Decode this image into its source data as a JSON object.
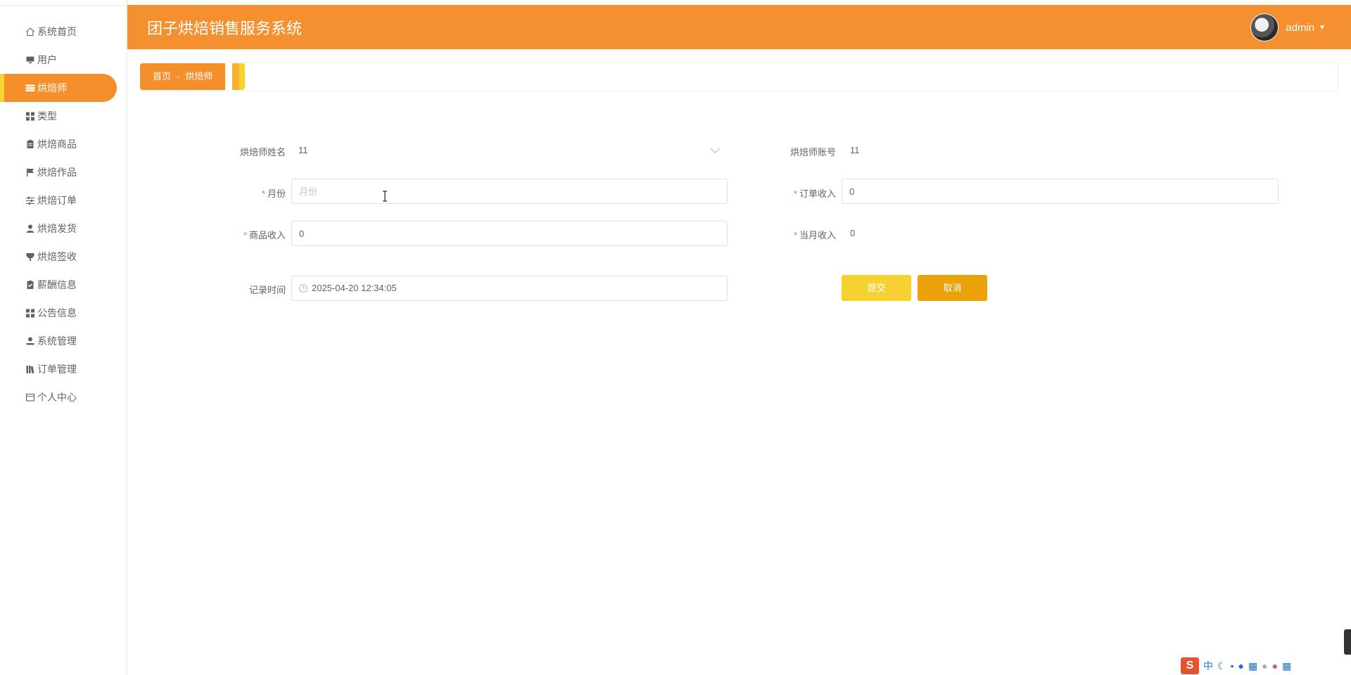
{
  "header": {
    "title": "团子烘焙销售服务系统",
    "username": "admin",
    "caret": "▼"
  },
  "sidebar": {
    "items": [
      {
        "label": "系统首页",
        "icon": "home-icon"
      },
      {
        "label": "用户",
        "icon": "monitor-icon"
      },
      {
        "label": "烘焙师",
        "icon": "list-icon",
        "active": true
      },
      {
        "label": "类型",
        "icon": "grid-icon"
      },
      {
        "label": "烘焙商品",
        "icon": "clipboard-icon"
      },
      {
        "label": "烘焙作品",
        "icon": "flag-icon"
      },
      {
        "label": "烘焙订单",
        "icon": "sliders-icon"
      },
      {
        "label": "烘焙发货",
        "icon": "user-icon"
      },
      {
        "label": "烘焙签收",
        "icon": "stamp-icon"
      },
      {
        "label": "薪酬信息",
        "icon": "clipboard-check-icon"
      },
      {
        "label": "公告信息",
        "icon": "grid-icon"
      },
      {
        "label": "系统管理",
        "icon": "user-icon"
      },
      {
        "label": "订单管理",
        "icon": "books-icon"
      },
      {
        "label": "个人中心",
        "icon": "wallet-icon"
      }
    ]
  },
  "breadcrumb": {
    "home": "首页",
    "separator": "-",
    "current": "烘焙师"
  },
  "form": {
    "baker_name": {
      "label": "烘焙师姓名",
      "value": "11"
    },
    "baker_account": {
      "label": "烘焙师账号",
      "value": "11"
    },
    "month": {
      "label": "月份",
      "placeholder": "月份",
      "value": ""
    },
    "order_income": {
      "label": "订单收入",
      "value": "0"
    },
    "goods_income": {
      "label": "商品收入",
      "value": "0"
    },
    "month_income": {
      "label": "当月收入",
      "value": "0"
    },
    "record_time": {
      "label": "记录时间",
      "value": "2025-04-20 12:34:05"
    },
    "required_mark": "*",
    "submit": "提交",
    "cancel": "取消"
  },
  "ime": {
    "logo": "S",
    "mode": "中"
  },
  "colors": {
    "primary": "#f58f2b",
    "header": "#f59030",
    "accent_yellow": "#f7d531",
    "submit": "#f7d131",
    "cancel": "#eba20a",
    "required": "#f56c6c"
  }
}
